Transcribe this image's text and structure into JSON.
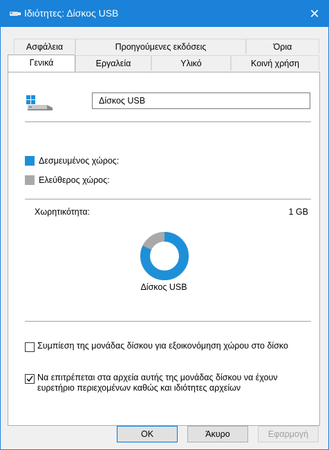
{
  "window": {
    "title": "Ιδιότητες: Δίσκος USB",
    "close_glyph": "✕"
  },
  "tabs": {
    "back_row": [
      "Ασφάλεια",
      "Προηγούμενες εκδόσεις",
      "Όρια"
    ],
    "front_row": [
      "Γενικά",
      "Εργαλεία",
      "Υλικό",
      "Κοινή χρήση"
    ],
    "active": "Γενικά"
  },
  "general": {
    "drive_name": "Δίσκος USB",
    "used_label": "Δεσμευμένος χώρος:",
    "free_label": "Ελεύθερος χώρος:",
    "capacity_label": "Χωρητικότητα:",
    "capacity_value": "1 GB",
    "donut_label": "Δίσκος USB",
    "used_fraction": 0.82,
    "compress_label": "Συμπίεση της μονάδας δίσκου για εξοικονόμηση χώρου στο δίσκο",
    "compress_checked": false,
    "index_label": "Να επιτρέπεται στα αρχεία αυτής της μονάδας δίσκου να έχουν ευρετήριο περιεχομένων καθώς και ιδιότητες αρχείων",
    "index_checked": true
  },
  "buttons": {
    "ok": "OK",
    "cancel": "Άκυρο",
    "apply": "Εφαρμογή"
  },
  "colors": {
    "used": "#1e90d8",
    "free": "#a9a9a9",
    "title_bar": "#1a82d8"
  },
  "icons": {
    "title": "usb-drive-icon",
    "drive": "usb-drive-icon",
    "close": "close-icon"
  }
}
